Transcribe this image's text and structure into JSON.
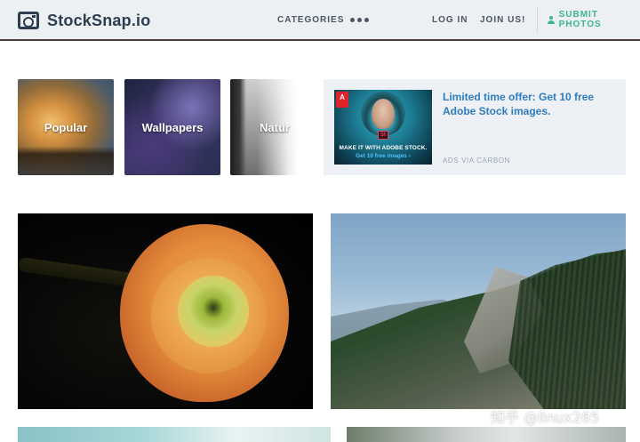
{
  "header": {
    "logo_text": "StockSnap.io",
    "nav": {
      "categories": "CATEGORIES",
      "more_icon": "ellipsis-icon",
      "login": "LOG IN",
      "join": "JOIN US!",
      "submit": "SUBMIT PHOTOS"
    },
    "colors": {
      "accent": "#3bb58f",
      "text": "#2c3e50",
      "header_bg": "#ecf0f3"
    }
  },
  "categories": [
    {
      "label": "Popular"
    },
    {
      "label": "Wallpapers"
    },
    {
      "label": "Natur"
    }
  ],
  "ad": {
    "image_line1": "MAKE IT WITH ADOBE STOCK.",
    "image_line2": "Get 10 free images ›",
    "brand_mark": "A",
    "product_mark": "St",
    "text": "Limited time offer: Get 10 free Adobe Stock images.",
    "via": "ADS VIA CARBON",
    "link_color": "#2f7cc1"
  },
  "photos": [
    {
      "subject": "orange ranunculus flower on black background"
    },
    {
      "subject": "forested mountain ridge with granite dome"
    },
    {
      "subject": "sky with clouds"
    },
    {
      "subject": "trees against sky"
    }
  ],
  "watermark": "知乎 @linux265"
}
